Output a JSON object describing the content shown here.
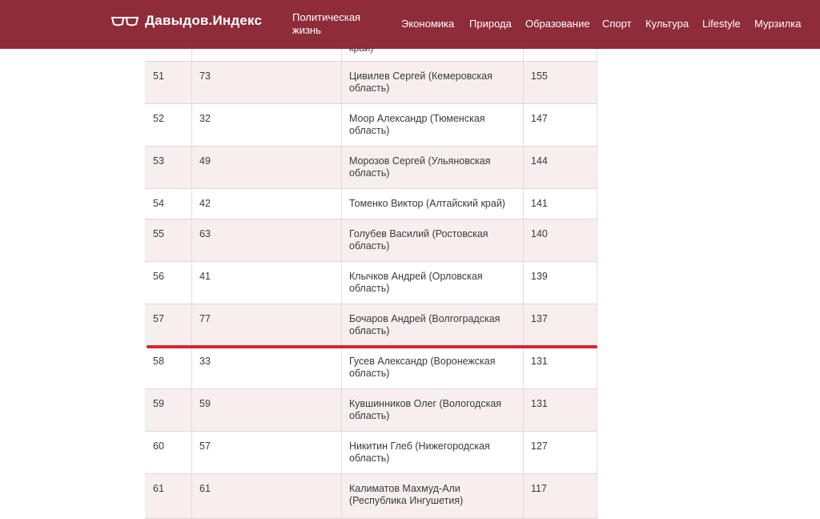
{
  "header": {
    "logo_text": "Давыдов.Индекс",
    "logo_icon": "glasses-icon",
    "nav": [
      {
        "label": "Политическая жизнь"
      },
      {
        "label": "Экономика"
      },
      {
        "label": "Природа"
      },
      {
        "label": "Образование"
      },
      {
        "label": "Спорт"
      },
      {
        "label": "Культура"
      },
      {
        "label": "Lifestyle"
      },
      {
        "label": "Мурзилка"
      }
    ]
  },
  "colors": {
    "header_bg": "#8e2c3a",
    "row_alt_bg": "#f6eeef",
    "divider_red": "#d9232f"
  },
  "table": {
    "partial_top_text": "край)",
    "rows": [
      {
        "rank": "51",
        "prev": "73",
        "name": "Цивилев Сергей (Кемеровская область)",
        "score": "155"
      },
      {
        "rank": "52",
        "prev": "32",
        "name": "Моор Александр (Тюменская область)",
        "score": "147"
      },
      {
        "rank": "53",
        "prev": "49",
        "name": "Морозов Сергей (Ульяновская область)",
        "score": "144"
      },
      {
        "rank": "54",
        "prev": "42",
        "name": "Томенко Виктор (Алтайский край)",
        "score": "141"
      },
      {
        "rank": "55",
        "prev": "63",
        "name": "Голубев Василий (Ростовская область)",
        "score": "140"
      },
      {
        "rank": "56",
        "prev": "41",
        "name": "Клычков Андрей (Орловская область)",
        "score": "139"
      },
      {
        "rank": "57",
        "prev": "77",
        "name": "Бочаров Андрей (Волгоградская область)",
        "score": "137"
      },
      {
        "rank": "58",
        "prev": "33",
        "name": "Гусев Александр (Воронежская область)",
        "score": "131"
      },
      {
        "rank": "59",
        "prev": "59",
        "name": "Кувшинников Олег (Вологодская область)",
        "score": "131"
      },
      {
        "rank": "60",
        "prev": "57",
        "name": "Никитин Глеб (Нижегородская область)",
        "score": "127"
      },
      {
        "rank": "61",
        "prev": "61",
        "name": "Калиматов Махмуд-Али (Республика Ингушетия)",
        "score": "117"
      }
    ]
  }
}
